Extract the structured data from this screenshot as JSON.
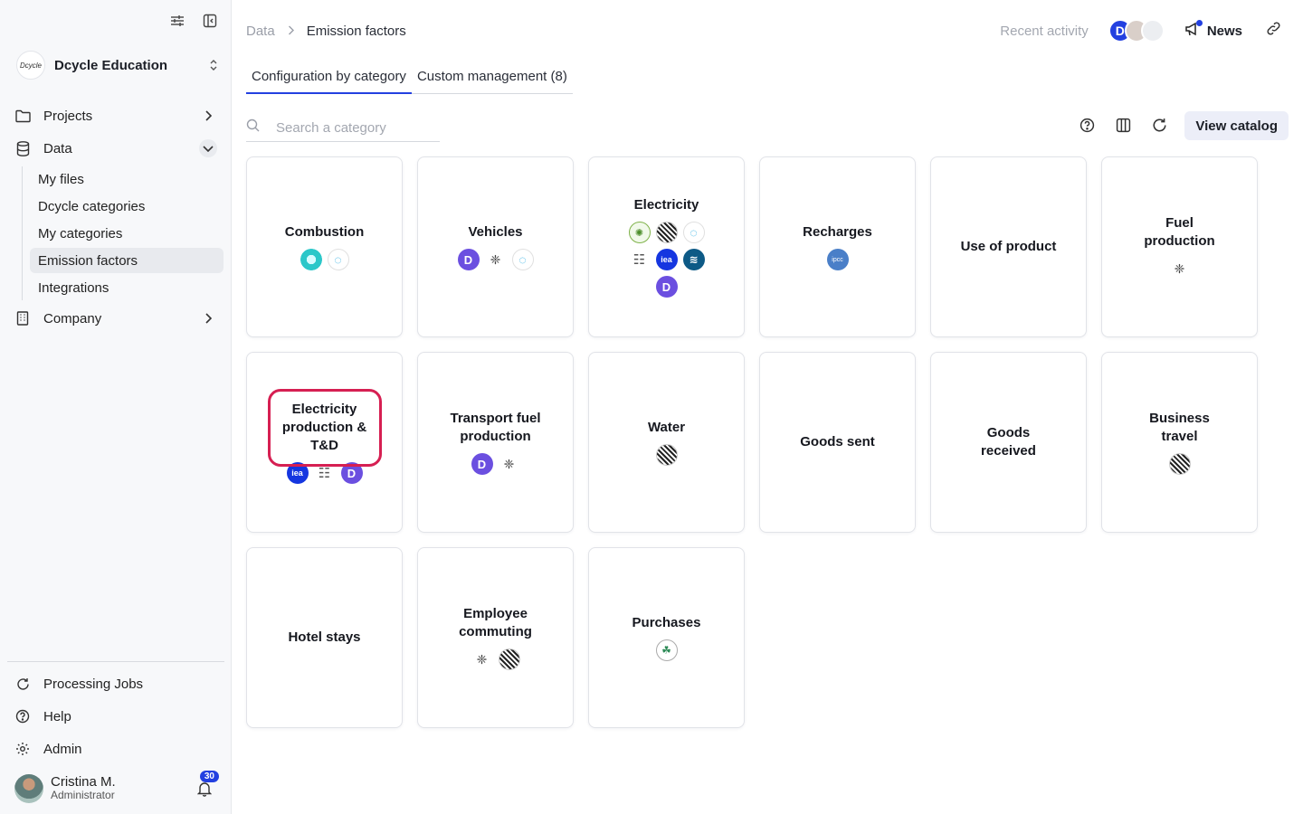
{
  "sidebar": {
    "org_logo_text": "Dcycle",
    "org_name": "Dcycle Education",
    "nav": {
      "projects": "Projects",
      "data": "Data",
      "company": "Company"
    },
    "data_sub": [
      "My files",
      "Dcycle categories",
      "My categories",
      "Emission factors",
      "Integrations"
    ],
    "bottom": {
      "processing_jobs": "Processing Jobs",
      "help": "Help",
      "admin": "Admin"
    },
    "user": {
      "name": "Cristina M.",
      "role": "Administrator",
      "notifications": "30"
    }
  },
  "header": {
    "breadcrumb": [
      "Data",
      "Emission factors"
    ],
    "breadcrumb_sep": ">",
    "recent_activity": "Recent activity",
    "news": "News"
  },
  "tabs": [
    "Configuration by category",
    "Custom management (8)"
  ],
  "search": {
    "placeholder": "Search a category"
  },
  "toolbar": {
    "view_catalog": "View catalog"
  },
  "categories": [
    {
      "title": "Combustion",
      "logos": [
        "teal-logo",
        "c-logo"
      ]
    },
    {
      "title": "Vehicles",
      "logos": [
        "dcycle-logo",
        "gov-crest-logo",
        "c-logo"
      ]
    },
    {
      "title": "Electricity",
      "logos": [
        "green-seal-logo",
        "striped-logo",
        "c-logo",
        "database-logo",
        "iea-logo",
        "wave-logo",
        "dcycle-logo"
      ]
    },
    {
      "title": "Recharges",
      "logos": [
        "ipcc-logo"
      ]
    },
    {
      "title": "Use of product",
      "logos": []
    },
    {
      "title": "Fuel production",
      "logos": [
        "gov-crest-logo"
      ]
    },
    {
      "title": "Electricity production & T&D",
      "logos": [
        "iea-logo",
        "database-logo",
        "dcycle-logo"
      ]
    },
    {
      "title": "Transport fuel production",
      "logos": [
        "dcycle-logo",
        "gov-crest-logo"
      ]
    },
    {
      "title": "Water",
      "logos": [
        "striped-logo"
      ]
    },
    {
      "title": "Goods sent",
      "logos": []
    },
    {
      "title": "Goods received",
      "logos": []
    },
    {
      "title": "Business travel",
      "logos": [
        "striped-logo"
      ]
    },
    {
      "title": "Hotel stays",
      "logos": []
    },
    {
      "title": "Employee commuting",
      "logos": [
        "gov-crest-logo",
        "striped-logo"
      ]
    },
    {
      "title": "Purchases",
      "logos": [
        "leaf-logo"
      ]
    }
  ],
  "logo_glyphs": {
    "iea": "iea",
    "ipcc": "ipcc",
    "dcycle": "D"
  },
  "colors": {
    "accent": "#2340e0",
    "highlight": "#d61f52",
    "dcycle": "#6b4fe0"
  }
}
